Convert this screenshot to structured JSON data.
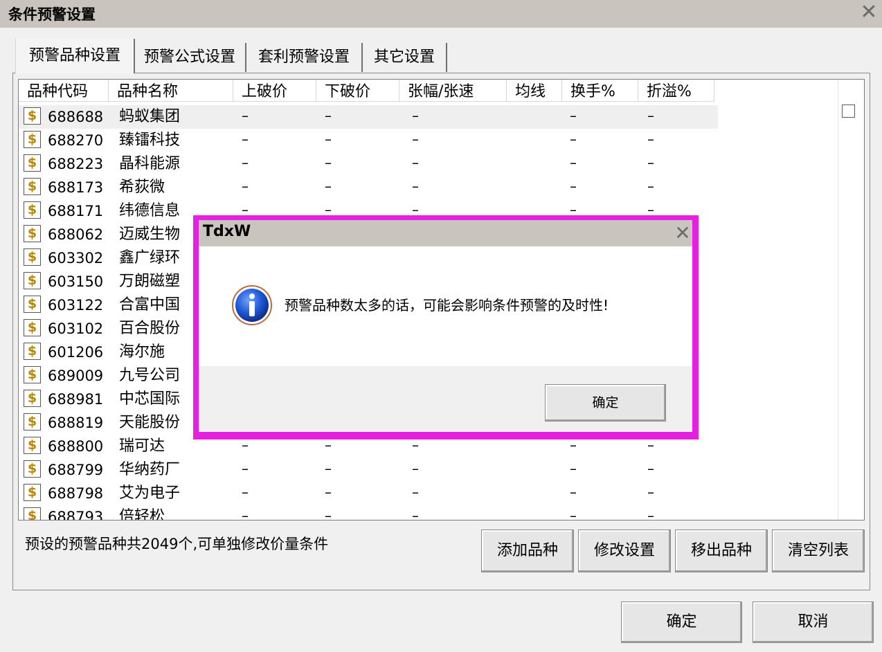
{
  "window": {
    "title": "条件预警设置"
  },
  "tabs": [
    {
      "label": "预警品种设置",
      "active": true
    },
    {
      "label": "预警公式设置",
      "active": false
    },
    {
      "label": "套利预警设置",
      "active": false
    },
    {
      "label": "其它设置",
      "active": false
    }
  ],
  "list": {
    "columns": [
      "品种代码",
      "品种名称",
      "上破价",
      "下破价",
      "张幅/张速",
      "均线",
      "换手%",
      "折溢%"
    ],
    "empty_value": "–",
    "icon_glyph": "$",
    "rows": [
      {
        "code": "688688",
        "name": "蚂蚁集团"
      },
      {
        "code": "688270",
        "name": "臻镭科技"
      },
      {
        "code": "688223",
        "name": "晶科能源"
      },
      {
        "code": "688173",
        "name": "希荻微"
      },
      {
        "code": "688171",
        "name": "纬德信息"
      },
      {
        "code": "688062",
        "name": "迈威生物"
      },
      {
        "code": "603302",
        "name": "鑫广绿环"
      },
      {
        "code": "603150",
        "name": "万朗磁塑"
      },
      {
        "code": "603122",
        "name": "合富中国"
      },
      {
        "code": "603102",
        "name": "百合股份"
      },
      {
        "code": "601206",
        "name": "海尔施"
      },
      {
        "code": "689009",
        "name": "九号公司"
      },
      {
        "code": "688981",
        "name": "中芯国际"
      },
      {
        "code": "688819",
        "name": "天能股份"
      },
      {
        "code": "688800",
        "name": "瑞可达"
      },
      {
        "code": "688799",
        "name": "华纳药厂"
      },
      {
        "code": "688798",
        "name": "艾为电子"
      },
      {
        "code": "688793",
        "name": "倍轻松"
      }
    ]
  },
  "summary": "预设的预警品种共2049个,可单独修改价量条件",
  "panel_buttons": {
    "add": "添加品种",
    "modify": "修改设置",
    "remove": "移出品种",
    "clear": "清空列表"
  },
  "dialog_buttons": {
    "ok": "确定",
    "cancel": "取消"
  },
  "message_box": {
    "title": "TdxW",
    "message": "预警品种数太多的话，可能会影响条件预警的及时性!",
    "ok": "确定",
    "highlight_color": "#e520e0"
  },
  "icons": {
    "close": "close-icon",
    "info": "info-icon",
    "row": "dollar-icon"
  }
}
